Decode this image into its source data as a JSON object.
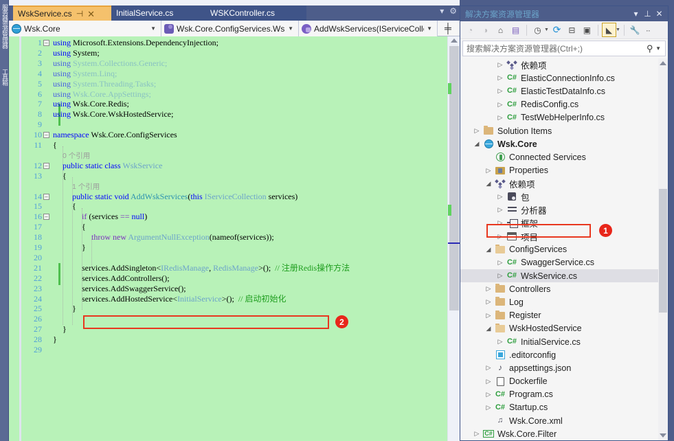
{
  "window": {
    "left_rail_tabs": [
      "服务器资源管理器",
      "工具箱"
    ]
  },
  "editor": {
    "tabs": [
      {
        "label": "WskService.cs",
        "active": true,
        "pin": "⊣",
        "close": "✕"
      },
      {
        "label": "InitialService.cs",
        "active": false
      },
      {
        "label": "WSKController.cs",
        "active": false
      }
    ],
    "tabstrip_icons": [
      "chevron-down-icon",
      "gear-icon"
    ],
    "navbar": {
      "project": "Wsk.Core",
      "type": "Wsk.Core.ConfigServices.Wsk",
      "member": "AddWskServices(IServiceColle",
      "split_icon": "split-view-icon"
    },
    "lines": [
      {
        "n": 1,
        "indent": 0,
        "fold": "minus",
        "tokens": [
          [
            "k",
            "using "
          ],
          [
            "p",
            "Microsoft.Extensions.DependencyInjection;"
          ]
        ]
      },
      {
        "n": 2,
        "indent": 0,
        "tokens": [
          [
            "k",
            "using "
          ],
          [
            "p",
            "System;"
          ]
        ]
      },
      {
        "n": 3,
        "indent": 0,
        "tokens": [
          [
            "k",
            "using "
          ],
          [
            "t",
            "System.Collections.Generic;"
          ]
        ],
        "dim": true
      },
      {
        "n": 4,
        "indent": 0,
        "tokens": [
          [
            "k",
            "using "
          ],
          [
            "t",
            "System.Linq;"
          ]
        ],
        "dim": true
      },
      {
        "n": 5,
        "indent": 0,
        "tokens": [
          [
            "k",
            "using "
          ],
          [
            "t",
            "System.Threading.Tasks;"
          ]
        ],
        "dim": true
      },
      {
        "n": 6,
        "indent": 0,
        "tokens": [
          [
            "k",
            "using "
          ],
          [
            "t",
            "Wsk.Core.AppSettings;"
          ]
        ],
        "dim": true
      },
      {
        "n": 7,
        "indent": 0,
        "tokens": [
          [
            "k",
            "using "
          ],
          [
            "p",
            "Wsk.Core.Redis;"
          ]
        ]
      },
      {
        "n": 8,
        "indent": 0,
        "tokens": [
          [
            "k",
            "using "
          ],
          [
            "p",
            "Wsk.Core.WskHostedService;"
          ]
        ]
      },
      {
        "n": 9,
        "indent": 0,
        "tokens": []
      },
      {
        "n": 10,
        "indent": 0,
        "fold": "minus",
        "tokens": [
          [
            "k",
            "namespace "
          ],
          [
            "p",
            "Wsk.Core.ConfigServices"
          ]
        ]
      },
      {
        "n": 11,
        "indent": 0,
        "tokens": [
          [
            "p",
            "{"
          ]
        ]
      },
      {
        "n": 0,
        "indent": 1,
        "reflabel": "0 个引用"
      },
      {
        "n": 12,
        "indent": 1,
        "fold": "minus",
        "tokens": [
          [
            "k",
            "public static class "
          ],
          [
            "t",
            "WskService"
          ]
        ]
      },
      {
        "n": 13,
        "indent": 1,
        "tokens": [
          [
            "p",
            "{"
          ]
        ]
      },
      {
        "n": 0,
        "indent": 2,
        "reflabel": "1 个引用"
      },
      {
        "n": 14,
        "indent": 2,
        "fold": "minus",
        "tokens": [
          [
            "k",
            "public static void "
          ],
          [
            "tn",
            "AddWskServices"
          ],
          [
            "p",
            "("
          ],
          [
            "k",
            "this "
          ],
          [
            "t",
            "IServiceCollection "
          ],
          [
            "p",
            "services)"
          ]
        ]
      },
      {
        "n": 15,
        "indent": 2,
        "tokens": [
          [
            "p",
            "{"
          ]
        ]
      },
      {
        "n": 16,
        "indent": 3,
        "fold": "minus",
        "tokens": [
          [
            "kp",
            "if "
          ],
          [
            "p",
            "(services "
          ],
          [
            "kp",
            "== "
          ],
          [
            "k",
            "null"
          ],
          [
            "p",
            ")"
          ]
        ]
      },
      {
        "n": 17,
        "indent": 3,
        "tokens": [
          [
            "p",
            "{"
          ]
        ]
      },
      {
        "n": 18,
        "indent": 4,
        "tokens": [
          [
            "kp",
            "throw "
          ],
          [
            "kp",
            "new "
          ],
          [
            "t",
            "ArgumentNullException"
          ],
          [
            "p",
            "(nameof(services));"
          ]
        ]
      },
      {
        "n": 19,
        "indent": 3,
        "tokens": [
          [
            "p",
            "}"
          ]
        ]
      },
      {
        "n": 20,
        "indent": 3,
        "tokens": []
      },
      {
        "n": 21,
        "indent": 3,
        "tokens": [
          [
            "p",
            "services.AddSingleton<"
          ],
          [
            "t",
            "IRedisManage"
          ],
          [
            "p",
            ", "
          ],
          [
            "t",
            "RedisManage"
          ],
          [
            "p",
            ">();  "
          ],
          [
            "cm",
            "// 注册Redis操作方法"
          ]
        ]
      },
      {
        "n": 22,
        "indent": 3,
        "tokens": [
          [
            "p",
            "services.AddControllers();"
          ]
        ]
      },
      {
        "n": 23,
        "indent": 3,
        "tokens": [
          [
            "p",
            "services.AddSwaggerService();"
          ]
        ]
      },
      {
        "n": 24,
        "indent": 3,
        "tokens": [
          [
            "p",
            "services.AddHostedService<"
          ],
          [
            "t",
            "InitialService"
          ],
          [
            "p",
            ">();  "
          ],
          [
            "cm",
            "// 启动初始化"
          ]
        ]
      },
      {
        "n": 25,
        "indent": 2,
        "tokens": [
          [
            "p",
            "}"
          ]
        ]
      },
      {
        "n": 26,
        "indent": 2,
        "tokens": []
      },
      {
        "n": 27,
        "indent": 1,
        "tokens": [
          [
            "p",
            "}"
          ]
        ]
      },
      {
        "n": 28,
        "indent": 0,
        "tokens": [
          [
            "p",
            "}"
          ]
        ]
      },
      {
        "n": 29,
        "indent": 0,
        "tokens": []
      }
    ],
    "annotation_badge": "2"
  },
  "solution_explorer": {
    "title": "解决方案资源管理器",
    "title_icons": [
      "chevron-down-icon",
      "pin-icon",
      "close-icon"
    ],
    "toolbar_icons": [
      "back-arrow-icon",
      "forward-arrow-icon",
      "home-icon",
      "vs-window-icon",
      "pending-changes-icon",
      "refresh-icon",
      "collapse-all-icon",
      "show-all-files-icon",
      "properties-view-icon",
      "wrench-icon",
      "overflow-icon"
    ],
    "search_placeholder": "搜索解决方案资源管理器(Ctrl+;)",
    "search_value": "",
    "search_icon": "magnifier-icon",
    "tree": [
      {
        "depth": 3,
        "arrow": "collapsed",
        "icon": "dependencies-icon",
        "label": "依赖项"
      },
      {
        "depth": 3,
        "arrow": "collapsed",
        "icon": "csharp-icon",
        "label": "ElasticConnectionInfo.cs"
      },
      {
        "depth": 3,
        "arrow": "collapsed",
        "icon": "csharp-icon",
        "label": "ElasticTestDataInfo.cs"
      },
      {
        "depth": 3,
        "arrow": "collapsed",
        "icon": "csharp-icon",
        "label": "RedisConfig.cs"
      },
      {
        "depth": 3,
        "arrow": "collapsed",
        "icon": "csharp-icon",
        "label": "TestWebHelperInfo.cs"
      },
      {
        "depth": 1,
        "arrow": "collapsed",
        "icon": "folder-icon",
        "label": "Solution Items"
      },
      {
        "depth": 1,
        "arrow": "expanded",
        "icon": "project-globe-icon",
        "label": "Wsk.Core",
        "bold": true
      },
      {
        "depth": 2,
        "arrow": "none",
        "icon": "connected-services-icon",
        "label": "Connected Services"
      },
      {
        "depth": 2,
        "arrow": "collapsed",
        "icon": "properties-icon",
        "label": "Properties"
      },
      {
        "depth": 2,
        "arrow": "expanded",
        "icon": "dependencies-icon",
        "label": "依赖项"
      },
      {
        "depth": 3,
        "arrow": "collapsed",
        "icon": "package-icon",
        "label": "包"
      },
      {
        "depth": 3,
        "arrow": "collapsed",
        "icon": "analyzer-icon",
        "label": "分析器"
      },
      {
        "depth": 3,
        "arrow": "collapsed",
        "icon": "framework-icon",
        "label": "框架"
      },
      {
        "depth": 3,
        "arrow": "collapsed",
        "icon": "projects-icon",
        "label": "项目"
      },
      {
        "depth": 2,
        "arrow": "expanded",
        "icon": "folder-open-icon",
        "label": "ConfigServices"
      },
      {
        "depth": 3,
        "arrow": "collapsed",
        "icon": "csharp-icon",
        "label": "SwaggerService.cs"
      },
      {
        "depth": 3,
        "arrow": "collapsed",
        "icon": "csharp-icon",
        "label": "WskService.cs",
        "selected": true,
        "highlight": true
      },
      {
        "depth": 2,
        "arrow": "collapsed",
        "icon": "folder-icon",
        "label": "Controllers"
      },
      {
        "depth": 2,
        "arrow": "collapsed",
        "icon": "folder-icon",
        "label": "Log"
      },
      {
        "depth": 2,
        "arrow": "collapsed",
        "icon": "folder-icon",
        "label": "Register"
      },
      {
        "depth": 2,
        "arrow": "expanded",
        "icon": "folder-open-icon",
        "label": "WskHostedService"
      },
      {
        "depth": 3,
        "arrow": "collapsed",
        "icon": "csharp-icon",
        "label": "InitialService.cs"
      },
      {
        "depth": 2,
        "arrow": "none",
        "icon": "editorconfig-icon",
        "label": ".editorconfig"
      },
      {
        "depth": 2,
        "arrow": "collapsed",
        "icon": "json-icon",
        "label": "appsettings.json"
      },
      {
        "depth": 2,
        "arrow": "collapsed",
        "icon": "file-icon",
        "label": "Dockerfile"
      },
      {
        "depth": 2,
        "arrow": "collapsed",
        "icon": "csharp-icon",
        "label": "Program.cs"
      },
      {
        "depth": 2,
        "arrow": "collapsed",
        "icon": "csharp-icon",
        "label": "Startup.cs"
      },
      {
        "depth": 2,
        "arrow": "none",
        "icon": "xml-icon",
        "label": "Wsk.Core.xml"
      },
      {
        "depth": 1,
        "arrow": "collapsed",
        "icon": "csharp-project-icon",
        "label": "Wsk.Core.Filter"
      }
    ],
    "annotation_badge": "1"
  },
  "colors": {
    "accent_blue": "#4d5d8a",
    "active_tab": "#f5c16c",
    "code_bg": "#b8f2b8",
    "annotation_red": "#e8371f",
    "keyword": "#0000ff",
    "comment_green": "#1f9e1f",
    "type_blue": "#6ba3c9"
  }
}
